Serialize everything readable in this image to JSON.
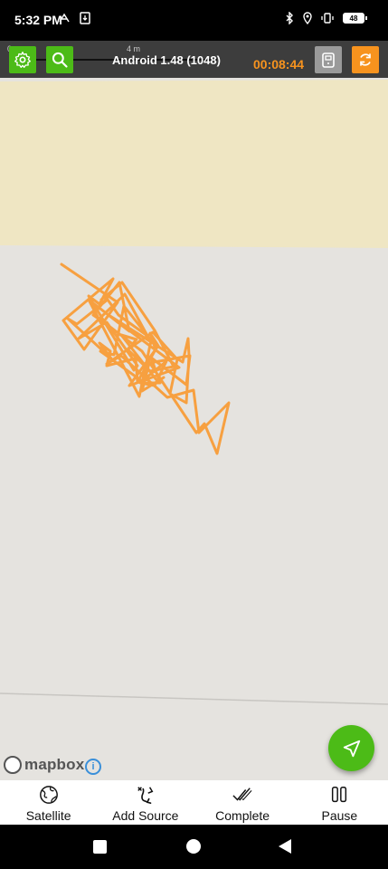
{
  "status_bar": {
    "time": "5:32 PM",
    "battery_level": "48"
  },
  "toolbar": {
    "scale_label_start": "0",
    "scale_label_end": "4 m",
    "app_version": "Android 1.48 (1048)",
    "timer": "00:08:44"
  },
  "map": {
    "attribution": "mapbox",
    "info_label": "i"
  },
  "bottom_nav": {
    "items": [
      {
        "label": "Satellite",
        "icon": "globe-icon"
      },
      {
        "label": "Add Source",
        "icon": "add-source-icon"
      },
      {
        "label": "Complete",
        "icon": "double-check-icon"
      },
      {
        "label": "Pause",
        "icon": "pause-icon"
      }
    ]
  },
  "colors": {
    "accent_green": "#4cbb17",
    "accent_orange": "#f7931e",
    "track_orange": "#f7a040",
    "map_land": "#e5e3df",
    "map_area": "#efe6c3"
  }
}
